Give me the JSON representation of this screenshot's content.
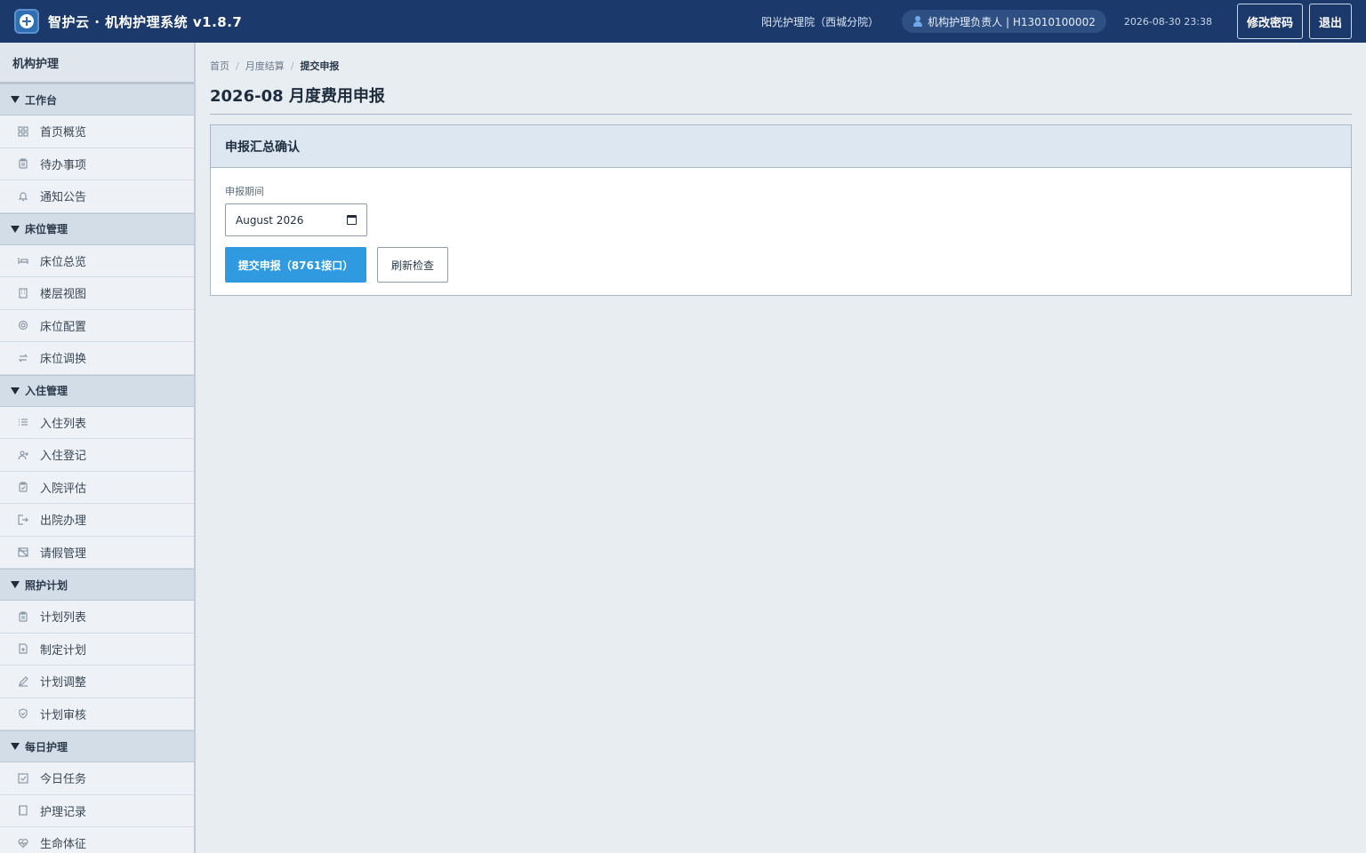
{
  "header": {
    "app_title": "智护云 · 机构护理系统 v1.8.7",
    "org_name": "阳光护理院（西城分院）",
    "user_label": "机构护理负责人 | H13010100002",
    "datetime": "2026-08-30 23:38",
    "change_password_label": "修改密码",
    "logout_label": "退出"
  },
  "sidebar": {
    "title": "机构护理",
    "groups": [
      {
        "label": "工作台",
        "items": [
          {
            "label": "首页概览",
            "icon": "grid-icon"
          },
          {
            "label": "待办事项",
            "icon": "clipboard-icon"
          },
          {
            "label": "通知公告",
            "icon": "bell-icon"
          }
        ]
      },
      {
        "label": "床位管理",
        "items": [
          {
            "label": "床位总览",
            "icon": "bed-icon"
          },
          {
            "label": "楼层视图",
            "icon": "building-icon"
          },
          {
            "label": "床位配置",
            "icon": "gear-icon"
          },
          {
            "label": "床位调换",
            "icon": "swap-icon"
          }
        ]
      },
      {
        "label": "入住管理",
        "items": [
          {
            "label": "入住列表",
            "icon": "list-icon"
          },
          {
            "label": "入住登记",
            "icon": "user-plus-icon"
          },
          {
            "label": "入院评估",
            "icon": "clipboard-check-icon"
          },
          {
            "label": "出院办理",
            "icon": "exit-icon"
          },
          {
            "label": "请假管理",
            "icon": "calendar-off-icon"
          }
        ]
      },
      {
        "label": "照护计划",
        "items": [
          {
            "label": "计划列表",
            "icon": "clipboard-icon"
          },
          {
            "label": "制定计划",
            "icon": "file-plus-icon"
          },
          {
            "label": "计划调整",
            "icon": "pencil-icon"
          },
          {
            "label": "计划审核",
            "icon": "shield-check-icon"
          }
        ]
      },
      {
        "label": "每日护理",
        "items": [
          {
            "label": "今日任务",
            "icon": "checkbox-icon"
          },
          {
            "label": "护理记录",
            "icon": "notebook-icon"
          },
          {
            "label": "生命体征",
            "icon": "heart-pulse-icon"
          }
        ]
      }
    ]
  },
  "breadcrumb": {
    "items": [
      "首页",
      "月度结算"
    ],
    "current": "提交申报"
  },
  "page_title": "2026-08 月度费用申报",
  "panel": {
    "title": "申报汇总确认",
    "period_label": "申报期间",
    "period_value": "August 2026",
    "submit_label": "提交申报（8761接口）",
    "refresh_label": "刷新检查"
  },
  "colors": {
    "header_bg": "#1b3a6b",
    "primary_button": "#2f9ae0",
    "sidebar_group_bg": "#d3dde8"
  }
}
